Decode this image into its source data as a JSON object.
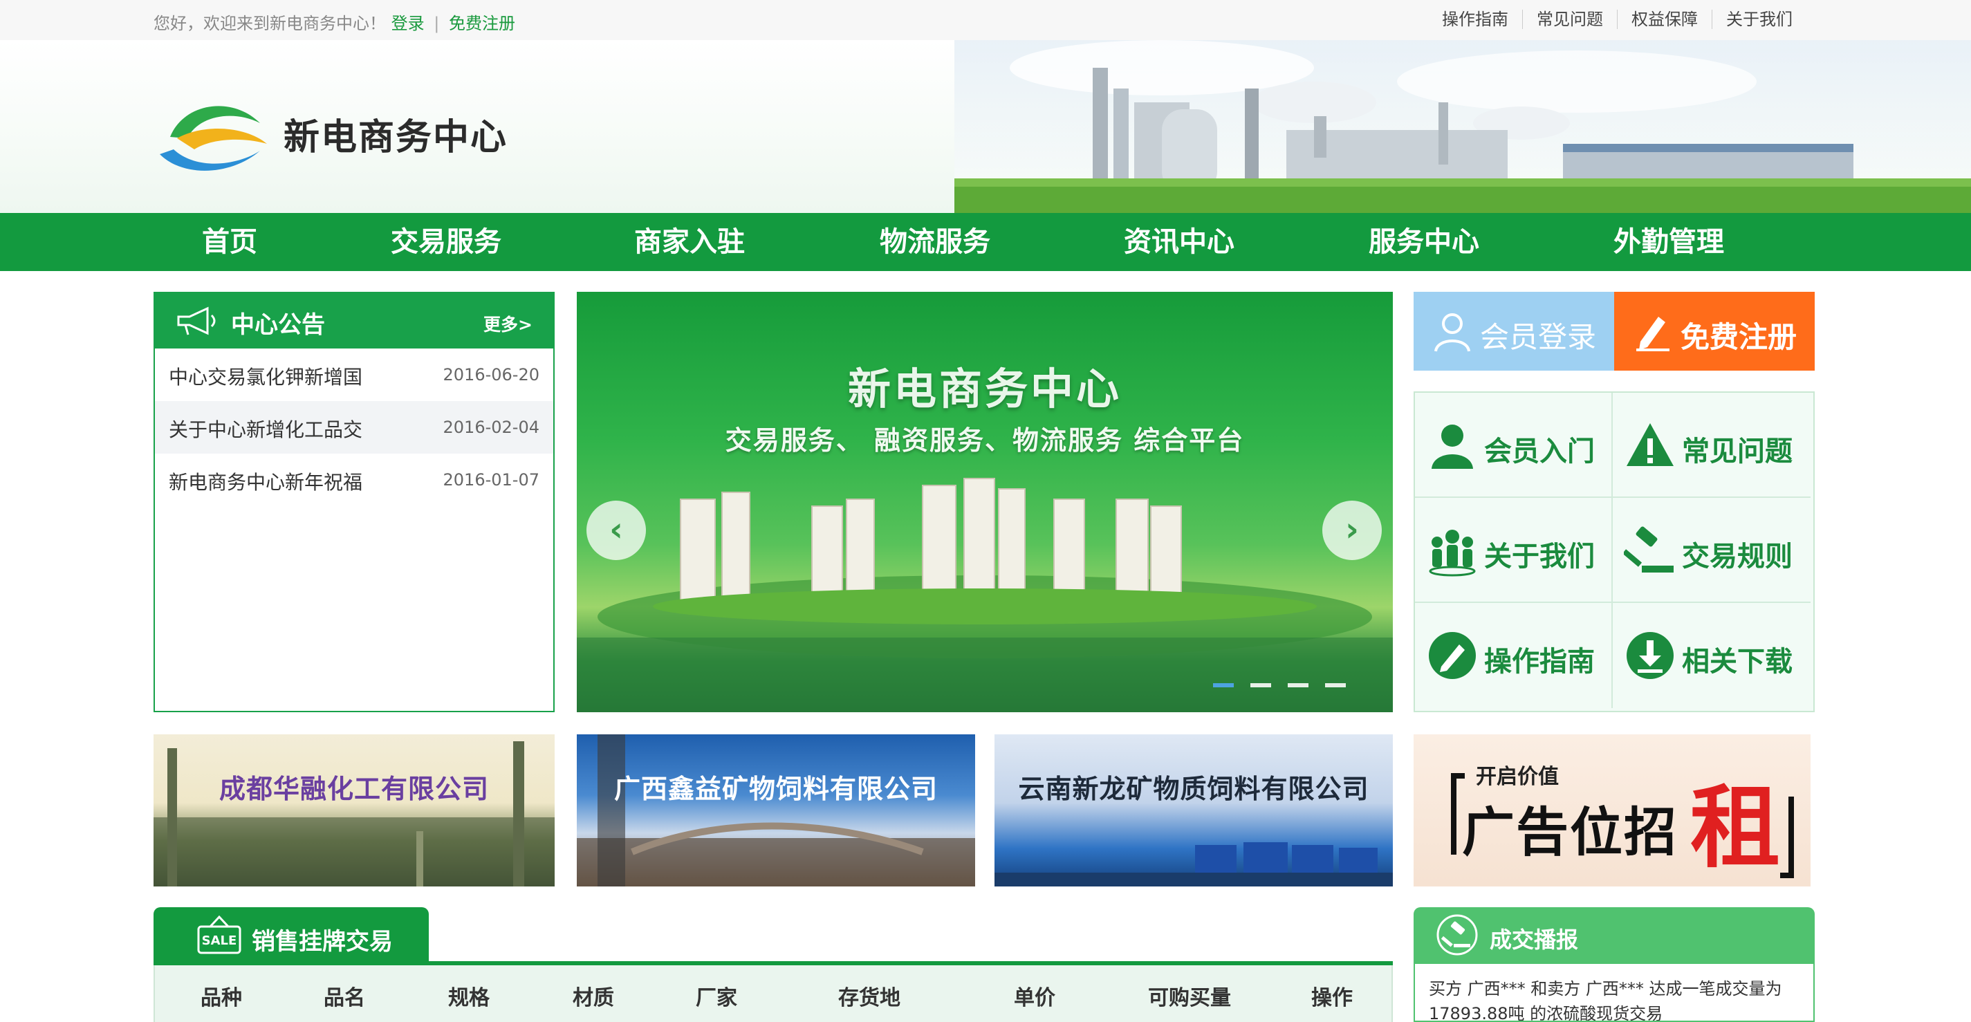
{
  "topbar": {
    "welcome": "您好，欢迎来到新电商务中心！",
    "login": "登录",
    "separator": "|",
    "register": "免费注册",
    "links": [
      "操作指南",
      "常见问题",
      "权益保障",
      "关于我们"
    ]
  },
  "header": {
    "brand": "新电商务中心"
  },
  "nav": {
    "items": [
      "首页",
      "交易服务",
      "商家入驻",
      "物流服务",
      "资讯中心",
      "服务中心",
      "外勤管理"
    ]
  },
  "notice": {
    "title": "中心公告",
    "more": "更多>",
    "items": [
      {
        "title": "中心交易氯化钾新增国",
        "date": "2016-06-20"
      },
      {
        "title": "关于中心新增化工品交",
        "date": "2016-02-04"
      },
      {
        "title": "新电商务中心新年祝福",
        "date": "2016-01-07"
      }
    ]
  },
  "banner": {
    "title": "新电商务中心",
    "subtitle": "交易服务、 融资服务、物流服务 综合平台",
    "prev": "‹",
    "next": "›",
    "slides": 4,
    "active_slide": 1
  },
  "account": {
    "login": "会员登录",
    "register": "免费注册"
  },
  "quick": {
    "items": [
      {
        "label": "会员入门",
        "icon": "user-icon"
      },
      {
        "label": "常见问题",
        "icon": "warning-icon"
      },
      {
        "label": "关于我们",
        "icon": "group-icon"
      },
      {
        "label": "交易规则",
        "icon": "gavel-icon"
      },
      {
        "label": "操作指南",
        "icon": "pencil-icon"
      },
      {
        "label": "相关下载",
        "icon": "download-icon"
      }
    ]
  },
  "ads": {
    "companies": [
      "成都华融化工有限公司",
      "广西鑫益矿物饲料有限公司",
      "云南新龙矿物质饲料有限公司"
    ],
    "rent_small": "开启价值",
    "rent_big": "广告位招",
    "rent_char": "租"
  },
  "sales": {
    "tab": "销售挂牌交易",
    "sale_badge": "SALE",
    "columns": [
      "品种",
      "品名",
      "规格",
      "材质",
      "厂家",
      "存货地",
      "单价",
      "可购买量",
      "操作"
    ]
  },
  "deals": {
    "title": "成交播报",
    "text": "买方 广西*** 和卖方 广西*** 达成一笔成交量为 17893.88吨 的浓硫酸现货交易"
  },
  "colors": {
    "brand_green": "#139a3f",
    "light_green": "#50c26f",
    "login_blue": "#9ed0f2",
    "register_orange": "#ff6c1a"
  }
}
